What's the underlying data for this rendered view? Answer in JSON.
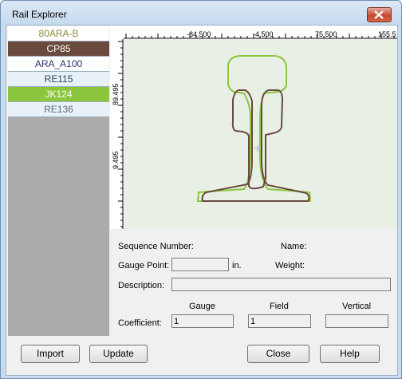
{
  "window": {
    "title": "Rail Explorer"
  },
  "rails": [
    {
      "name": "80ARA-B",
      "bg": "#ffffff",
      "fg": "#8a8a3c"
    },
    {
      "name": "CP85",
      "bg": "#6b4a3e",
      "fg": "#ffffff"
    },
    {
      "name": "ARA_A100",
      "bg": "#ffffff",
      "fg": "#2c2c6e"
    },
    {
      "name": "RE115",
      "bg": "#e9f1f8",
      "fg": "#2c4a5c"
    },
    {
      "name": "JK124",
      "bg": "#8cc63e",
      "fg": "#ffffff"
    },
    {
      "name": "RE136",
      "bg": "#e9f1f8",
      "fg": "#5b6b7a"
    }
  ],
  "ruler": {
    "x_ticks": [
      "-84.500",
      "-4.500",
      "75.500",
      "155.5"
    ],
    "y_ticks": [
      "89.495",
      "9.495"
    ]
  },
  "profile_colors": {
    "brown": "#6b4a3e",
    "green": "#8cc63e"
  },
  "details": {
    "sequence_label": "Sequence Number:",
    "name_label": "Name:",
    "gauge_point_label": "Gauge Point:",
    "gauge_point_value": "",
    "gauge_point_unit": "in.",
    "weight_label": "Weight:",
    "description_label": "Description:",
    "description_value": "",
    "coefficient_label": "Coefficient:",
    "col_gauge": "Gauge",
    "col_field": "Field",
    "col_vertical": "Vertical",
    "gauge_value": "1",
    "field_value": "1",
    "vertical_value": ""
  },
  "buttons": {
    "import": "Import",
    "update": "Update",
    "close": "Close",
    "help": "Help"
  }
}
